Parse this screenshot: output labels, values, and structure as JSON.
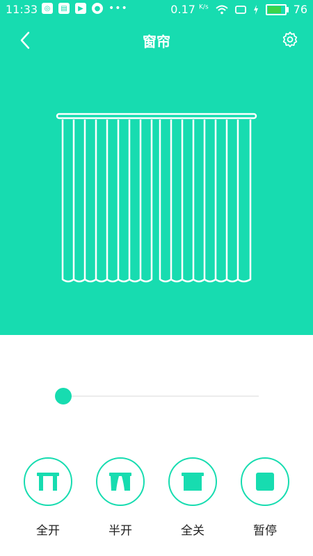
{
  "colors": {
    "accent": "#17dcb0",
    "background": "#ffffff",
    "text": "#222222"
  },
  "status_bar": {
    "time": "11:33",
    "network_speed": "0.17",
    "network_unit": "K/s",
    "battery": "76",
    "icons": [
      "sync-icon",
      "news-icon",
      "video-icon",
      "account-icon",
      "more-dots-icon",
      "wifi-icon",
      "screen-icon",
      "charging-icon",
      "battery-icon"
    ]
  },
  "header": {
    "title": "窗帘",
    "back_icon": "chevron-left-icon",
    "settings_icon": "gear-icon"
  },
  "slider": {
    "value_percent": 4
  },
  "controls": [
    {
      "label": "全开",
      "icon": "curtain-full-open-icon"
    },
    {
      "label": "半开",
      "icon": "curtain-half-open-icon"
    },
    {
      "label": "全关",
      "icon": "curtain-closed-icon"
    },
    {
      "label": "暂停",
      "icon": "pause-square-icon"
    }
  ]
}
